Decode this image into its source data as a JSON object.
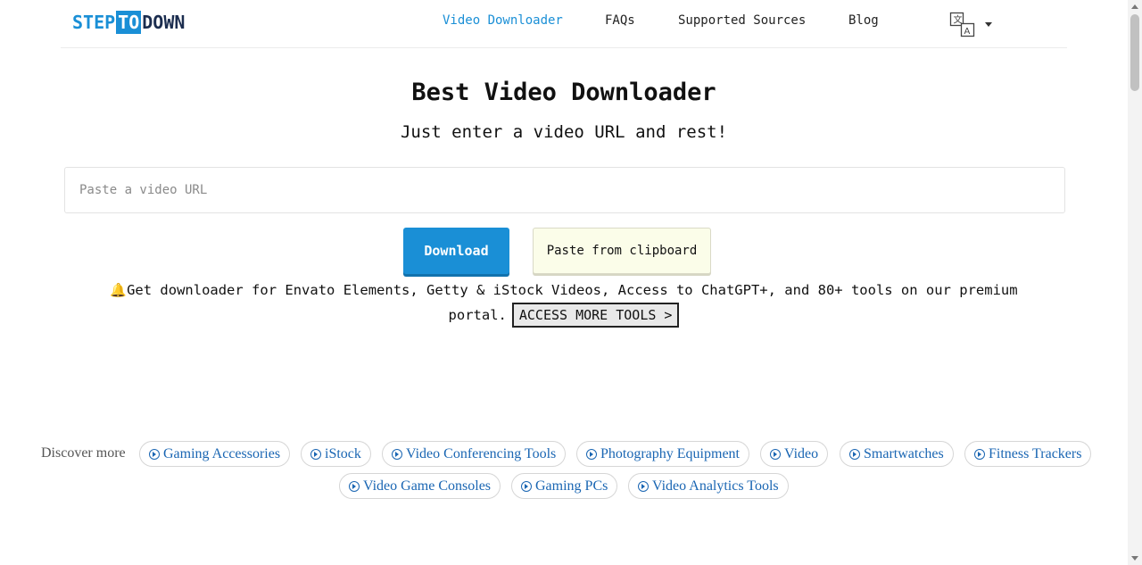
{
  "header": {
    "logo": {
      "part1": "STEP",
      "part2": "TO",
      "part3": "DOWN"
    },
    "nav": [
      {
        "label": "Video Downloader",
        "active": true
      },
      {
        "label": "FAQs",
        "active": false
      },
      {
        "label": "Supported Sources",
        "active": false
      },
      {
        "label": "Blog",
        "active": false
      }
    ],
    "language_icon": "translate-icon"
  },
  "hero": {
    "title": "Best Video Downloader",
    "subtitle": "Just enter a video URL and rest!"
  },
  "form": {
    "url_placeholder": "Paste a video URL",
    "url_value": "",
    "download_label": "Download",
    "paste_label": "Paste from clipboard"
  },
  "promo": {
    "icon": "bell-icon",
    "bell_glyph": "🔔",
    "text": "Get downloader for Envato Elements, Getty & iStock Videos, Access to ChatGPT+, and 80+ tools on our premium portal.",
    "access_label": "ACCESS MORE TOOLS >"
  },
  "discover": {
    "label": "Discover more",
    "chips": [
      "Gaming Accessories",
      "iStock",
      "Video Conferencing Tools",
      "Photography Equipment",
      "Video",
      "Smartwatches",
      "Fitness Trackers",
      "Video Game Consoles",
      "Gaming PCs",
      "Video Analytics Tools"
    ]
  },
  "colors": {
    "brand_blue": "#1a8fd6",
    "logo_dark": "#1b2d4f",
    "chip_text": "#1a66b3",
    "paste_button_bg": "#fbfde9"
  }
}
